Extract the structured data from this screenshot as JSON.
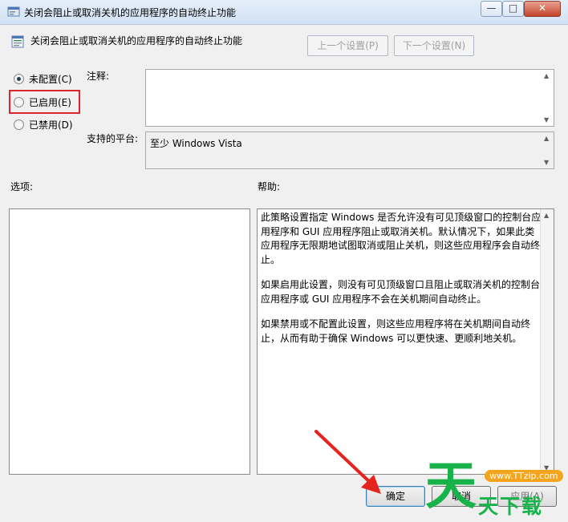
{
  "window": {
    "title": "关闭会阻止或取消关机的应用程序的自动终止功能",
    "min_label": "—",
    "max_label": "□",
    "close_label": "✕"
  },
  "header": {
    "policy_name": "关闭会阻止或取消关机的应用程序的自动终止功能",
    "prev_label": "上一个设置(P)",
    "next_label": "下一个设置(N)"
  },
  "state": {
    "options": [
      {
        "label": "未配置(C)",
        "checked": true
      },
      {
        "label": "已启用(E)",
        "checked": false
      },
      {
        "label": "已禁用(D)",
        "checked": false
      }
    ]
  },
  "comment": {
    "label": "注释:",
    "value": ""
  },
  "platform": {
    "label": "支持的平台:",
    "value": "至少 Windows Vista"
  },
  "options_panel": {
    "label": "选项:"
  },
  "help_panel": {
    "label": "帮助:",
    "paragraphs": [
      "此策略设置指定 Windows 是否允许没有可见顶级窗口的控制台应用程序和 GUI 应用程序阻止或取消关机。默认情况下，如果此类应用程序无限期地试图取消或阻止关机，则这些应用程序会自动终止。",
      "如果启用此设置，则没有可见顶级窗口且阻止或取消关机的控制台应用程序或 GUI 应用程序不会在关机期间自动终止。",
      "如果禁用或不配置此设置，则这些应用程序将在关机期间自动终止，从而有助于确保 Windows 可以更快速、更顺利地关机。"
    ]
  },
  "buttons": {
    "ok_label": "确定",
    "cancel_label": "取消",
    "apply_label": "应用(A)"
  },
  "watermark": {
    "site": "www.TTzip.com",
    "brand": "天下载"
  },
  "colors": {
    "highlight_box": "#d9252b",
    "arrow": "#e5231f",
    "watermark_green": "#17b34a"
  }
}
